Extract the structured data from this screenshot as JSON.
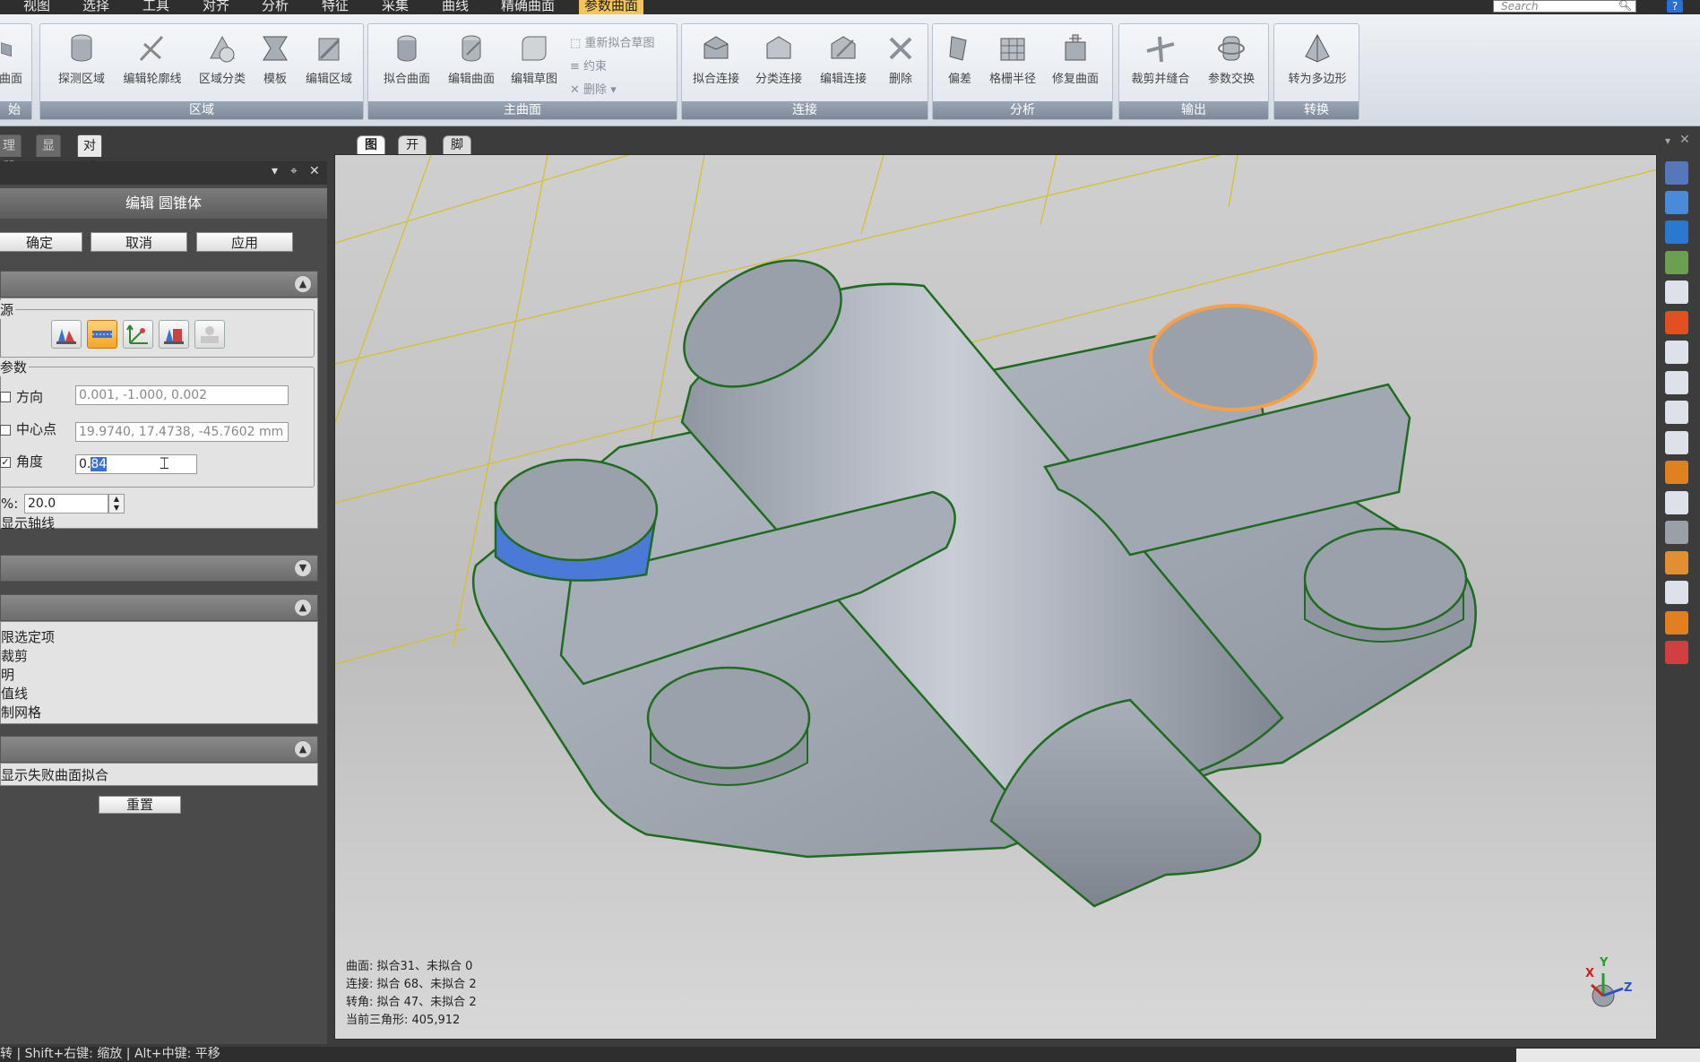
{
  "menu": [
    "视图",
    "选择",
    "工具",
    "对齐",
    "分析",
    "特征",
    "采集",
    "曲线",
    "精确曲面",
    "参数曲面"
  ],
  "search": {
    "placeholder": "Search"
  },
  "ribbon": {
    "groups": {
      "start": "始",
      "region": "区域",
      "main_surface": "主曲面",
      "connect": "连接",
      "analysis": "分析",
      "output": "输出",
      "convert": "转换"
    },
    "tools": {
      "surface_partial": "曲面",
      "detect_region": "探测区域",
      "edit_contour": "编辑轮廓线",
      "region_classify": "区域分类",
      "template": "模板",
      "edit_region": "编辑区域",
      "fit_surface": "拟合曲面",
      "edit_surface": "编辑曲面",
      "edit_sketch": "编辑草图",
      "refit_sketch": "重新拟合草图",
      "constraint": "约束",
      "delete_small": "删除",
      "fit_connect": "拟合连接",
      "classify_connect": "分类连接",
      "edit_connect": "编辑连接",
      "delete": "删除",
      "deviation": "偏差",
      "grid_radius": "格栅半径",
      "repair_surface": "修复曲面",
      "trim_stitch": "裁剪并缝合",
      "param_exchange": "参数交换",
      "to_polygon": "转为多边形"
    }
  },
  "panel_tabs": [
    "理器",
    "显示",
    "对话框"
  ],
  "dialog": {
    "title": "编辑 圆锥体",
    "ok": "确定",
    "cancel": "取消",
    "apply": "应用",
    "source_legend": "源",
    "params_legend": "参数",
    "direction_label": "方向",
    "direction_value": "0.001, -1.000, 0.002",
    "center_label": "中心点",
    "center_value": "19.9740, 17.4738, -45.7602 mm",
    "angle_label": "角度",
    "angle_prefix": "0.",
    "angle_selected": "84",
    "percent_label": "%:",
    "percent_value": "20.0",
    "show_axis": "显示轴线",
    "options": [
      "限选定项",
      "裁剪",
      "明",
      "值线",
      "制网格"
    ],
    "show_failed": "显示失败曲面拟合",
    "reset": "重置"
  },
  "view_tabs": [
    "图形",
    "开始",
    "脚本"
  ],
  "stats": [
    "曲面: 拟合31、未拟合 0",
    "连接: 拟合 68、未拟合 2",
    "转角: 拟合 47、未拟合 2",
    "当前三角形: 405,912"
  ],
  "triad": {
    "x": "X",
    "y": "Y",
    "z": "Z"
  },
  "status": "转 | Shift+右键: 缩放 | Alt+中键: 平移",
  "colors": {
    "accent": "#f3c45a",
    "edge": "#1f6b1f",
    "highlight": "#f5a04a",
    "selected_face": "#4a7ad8"
  }
}
